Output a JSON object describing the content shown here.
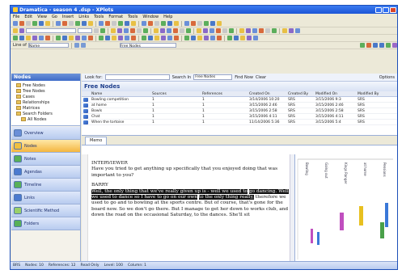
{
  "window": {
    "title": "Dramatica - season 4 .dsp - XPlots"
  },
  "menu": [
    "File",
    "Edit",
    "View",
    "Go",
    "Insert",
    "Links",
    "Tools",
    "Format",
    "Tools",
    "Window",
    "Help"
  ],
  "toolbar4": {
    "label": "Line of",
    "placeholder": "Name",
    "find_label": "Free Nodes"
  },
  "left": {
    "header": "Nodes",
    "tree": [
      {
        "label": "Free Nodes"
      },
      {
        "label": "Tree Nodes"
      },
      {
        "label": "Cases"
      },
      {
        "label": "Relationships"
      },
      {
        "label": "Matrices"
      },
      {
        "label": "Search Folders"
      },
      {
        "label": "All Nodes"
      }
    ],
    "nav": [
      {
        "label": "Overview"
      },
      {
        "label": "Nodes"
      },
      {
        "label": "Notes"
      },
      {
        "label": "Agendas"
      },
      {
        "label": "Timeline"
      },
      {
        "label": "Links"
      },
      {
        "label": "Scientific Method"
      },
      {
        "label": "Folders"
      }
    ]
  },
  "findbar": {
    "look_for": "Look for:",
    "search_in_label": "Search In",
    "search_in_value": "Free Nodes",
    "find_now": "Find Now",
    "clear": "Clear",
    "options": "Options"
  },
  "list": {
    "title": "Free Nodes",
    "columns": [
      "",
      "Name",
      "Sources",
      "References",
      "Created On",
      "Created By",
      "Modified On",
      "Modified By"
    ],
    "rows": [
      [
        "",
        "Bowling competition",
        "1",
        "1",
        "3/14/2006 10:20",
        "SRS",
        "3/15/2006 9:3",
        "SRS"
      ],
      [
        "",
        "at home",
        "1",
        "1",
        "3/15/2006 2:46",
        "SRS",
        "3/15/2006 2:46",
        "SRS"
      ],
      [
        "",
        "Bowls",
        "1",
        "1",
        "3/15/2006 2:58",
        "SRS",
        "3/15/2006 2:58",
        "SRS"
      ],
      [
        "",
        "Chat",
        "1",
        "1",
        "3/15/2006 4:11",
        "SRS",
        "3/15/2006 4:11",
        "SRS"
      ],
      [
        "",
        "When the tortoise",
        "1",
        "1",
        "11/14/2006 5:36",
        "SRS",
        "3/15/2006 5:4",
        "SRS"
      ]
    ]
  },
  "tab": {
    "label": "Memo"
  },
  "doc": {
    "interviewer_1": "INTERVIEWER",
    "q1": "Have you tried to get anything up specifically that you enjoyed doing that was important to you?",
    "barry": "BARRY",
    "hl1": "Well, the only thing that we've really given up is - well we used to",
    "hl2": "go dancing. Well we used to dance so I have to go on our own",
    "hl3": "to the only thing really,",
    "rest": " therefore we used to go and to bowling at the sports centre. But of course, that's gone for the board now. So we don't go there. But I manage to get her down to works club, and down the road on the occasional Saturday, to the dances. She'll sit"
  },
  "timeline": {
    "labels": [
      "Bowling",
      "Going out",
      "Kings Ranger",
      "at home",
      "Pensions"
    ],
    "colors": {
      "bar1": "#c04fbf",
      "bar2": "#e8c020",
      "bar3": "#4aa04a",
      "bar4": "#3a78d8"
    }
  },
  "status": [
    "BRS",
    "Nodes: 10",
    "References: 12",
    "Read Only",
    "Level: 100",
    "Column: 1"
  ]
}
